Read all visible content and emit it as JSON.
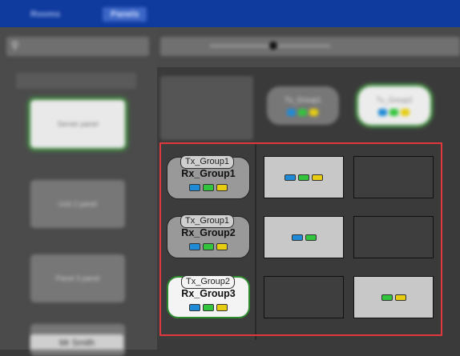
{
  "top_tabs": [
    "Rooms",
    "Panels"
  ],
  "left_cards": [
    "Server panel",
    "Unit 2 panel",
    "Panel 3 panel"
  ],
  "bottom_label": "Mr Smith",
  "tx_columns": [
    {
      "label": "Tx_Group1",
      "selected": false
    },
    {
      "label": "Tx_Group2",
      "selected": true
    }
  ],
  "rx_rows": [
    {
      "tx": "Tx_Group1",
      "rx": "Rx_Group1",
      "selected": false
    },
    {
      "tx": "Tx_Group1",
      "rx": "Rx_Group2",
      "selected": false
    },
    {
      "tx": "Tx_Group2",
      "rx": "Rx_Group3",
      "selected": true
    }
  ],
  "colors": {
    "highlight": "#e0383c",
    "selection_green": "#2f8b2f",
    "led_blue": "#1f8ad6",
    "led_green": "#33c43d",
    "led_yellow": "#e6cd12",
    "topbar": "#0f3a9e"
  }
}
